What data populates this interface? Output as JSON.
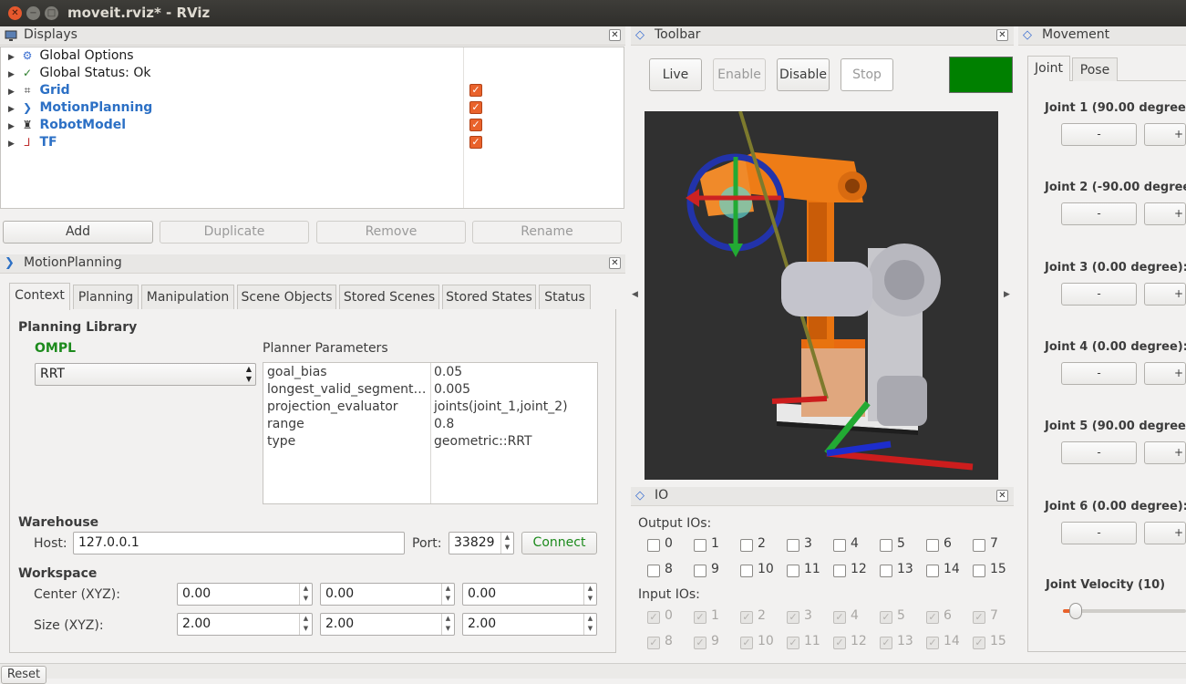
{
  "window": {
    "title": "moveit.rviz* - RViz"
  },
  "displays": {
    "title": "Displays",
    "items": [
      {
        "label": "Global Options",
        "checked": false
      },
      {
        "label": "Global Status: Ok",
        "checked": false
      },
      {
        "label": "Grid",
        "checked": true
      },
      {
        "label": "MotionPlanning",
        "checked": true
      },
      {
        "label": "RobotModel",
        "checked": true
      },
      {
        "label": "TF",
        "checked": true
      }
    ],
    "buttons": {
      "add": "Add",
      "duplicate": "Duplicate",
      "remove": "Remove",
      "rename": "Rename"
    }
  },
  "motion_planning": {
    "title": "MotionPlanning",
    "tabs": [
      "Context",
      "Planning",
      "Manipulation",
      "Scene Objects",
      "Stored Scenes",
      "Stored States",
      "Status"
    ],
    "active_tab": "Context",
    "planning_library": {
      "heading": "Planning Library",
      "library": "OMPL",
      "planner": "RRT",
      "params_heading": "Planner Parameters",
      "params": [
        {
          "name": "goal_bias",
          "value": "0.05"
        },
        {
          "name": "longest_valid_segment…",
          "value": "0.005"
        },
        {
          "name": "projection_evaluator",
          "value": "joints(joint_1,joint_2)"
        },
        {
          "name": "range",
          "value": "0.8"
        },
        {
          "name": "type",
          "value": "geometric::RRT"
        }
      ]
    },
    "warehouse": {
      "heading": "Warehouse",
      "host_label": "Host:",
      "host": "127.0.0.1",
      "port_label": "Port:",
      "port": "33829",
      "connect": "Connect"
    },
    "workspace": {
      "heading": "Workspace",
      "center_label": "Center (XYZ):",
      "center": [
        "0.00",
        "0.00",
        "0.00"
      ],
      "size_label": "Size (XYZ):",
      "size": [
        "2.00",
        "2.00",
        "2.00"
      ]
    }
  },
  "toolbar": {
    "title": "Toolbar",
    "live": "Live",
    "enable": "Enable",
    "disable": "Disable",
    "stop": "Stop",
    "status_color": "#008000"
  },
  "io": {
    "title": "IO",
    "output_label": "Output IOs:",
    "input_label": "Input IOs:",
    "channels": [
      "0",
      "1",
      "2",
      "3",
      "4",
      "5",
      "6",
      "7",
      "8",
      "9",
      "10",
      "11",
      "12",
      "13",
      "14",
      "15"
    ]
  },
  "movement": {
    "title": "Movement",
    "tabs": [
      "Joint",
      "Pose"
    ],
    "active_tab": "Joint",
    "joints": [
      {
        "label": "Joint 1 (90.00 degree)"
      },
      {
        "label": "Joint 2 (-90.00 degree"
      },
      {
        "label": "Joint 3 (0.00 degree):"
      },
      {
        "label": "Joint 4 (0.00 degree):"
      },
      {
        "label": "Joint 5 (90.00 degree)"
      },
      {
        "label": "Joint 6 (0.00 degree):"
      }
    ],
    "minus": "-",
    "plus": "+",
    "velocity_label": "Joint Velocity (10)",
    "velocity_fraction": 0.1
  },
  "bottom": {
    "reset": "Reset"
  },
  "colors": {
    "accent": "#e9622b",
    "link_blue": "#2c70c5",
    "ompl_green": "#1c8a1c",
    "viewport_bg": "#303030"
  }
}
